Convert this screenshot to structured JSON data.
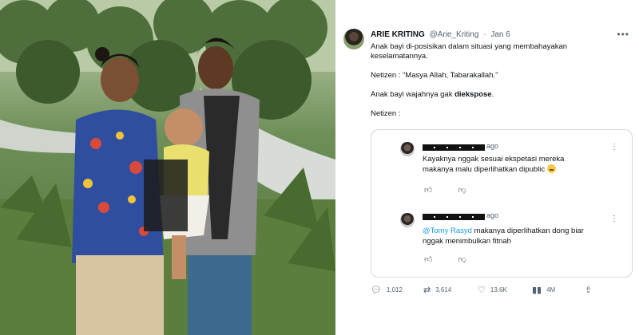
{
  "photo": {
    "description_icon": "photo-image"
  },
  "tweet": {
    "author_name": "ARIE KRITING",
    "handle": "@Arie_Kriting",
    "separator": "·",
    "date": "Jan 6",
    "more_icon": "more-horizontal-icon",
    "body": {
      "line1": "Anak bayi di-posisikan dalam situasi yang membahayakan keselamatannya.",
      "line2": "Netizen : “Masya Allah, Tabarakallah.”",
      "line3_prefix": "Anak bayi wajahnya gak ",
      "line3_bold": "diekspose",
      "line3_suffix": ".",
      "line4": "Netizen :"
    },
    "quoted_replies": [
      {
        "time": "ago",
        "text_line1": "Kayaknya nggak sesuai ekspetasi mereka",
        "text_line2": "makanya malu diperlihatkan dipublic",
        "icons": [
          "reply-icon",
          "reply-alt-icon"
        ]
      },
      {
        "time": "ago",
        "mention": "@Tomy Rasyd",
        "text_line1": " makanya diperlihatkan dong biar",
        "text_line2": "nggak menimbulkan fitnah",
        "icons": [
          "reply-icon",
          "reply-alt-icon"
        ]
      }
    ],
    "actions": {
      "replies": "1,012",
      "retweets": "3,614",
      "likes": "13.6K",
      "views": "4M"
    }
  }
}
